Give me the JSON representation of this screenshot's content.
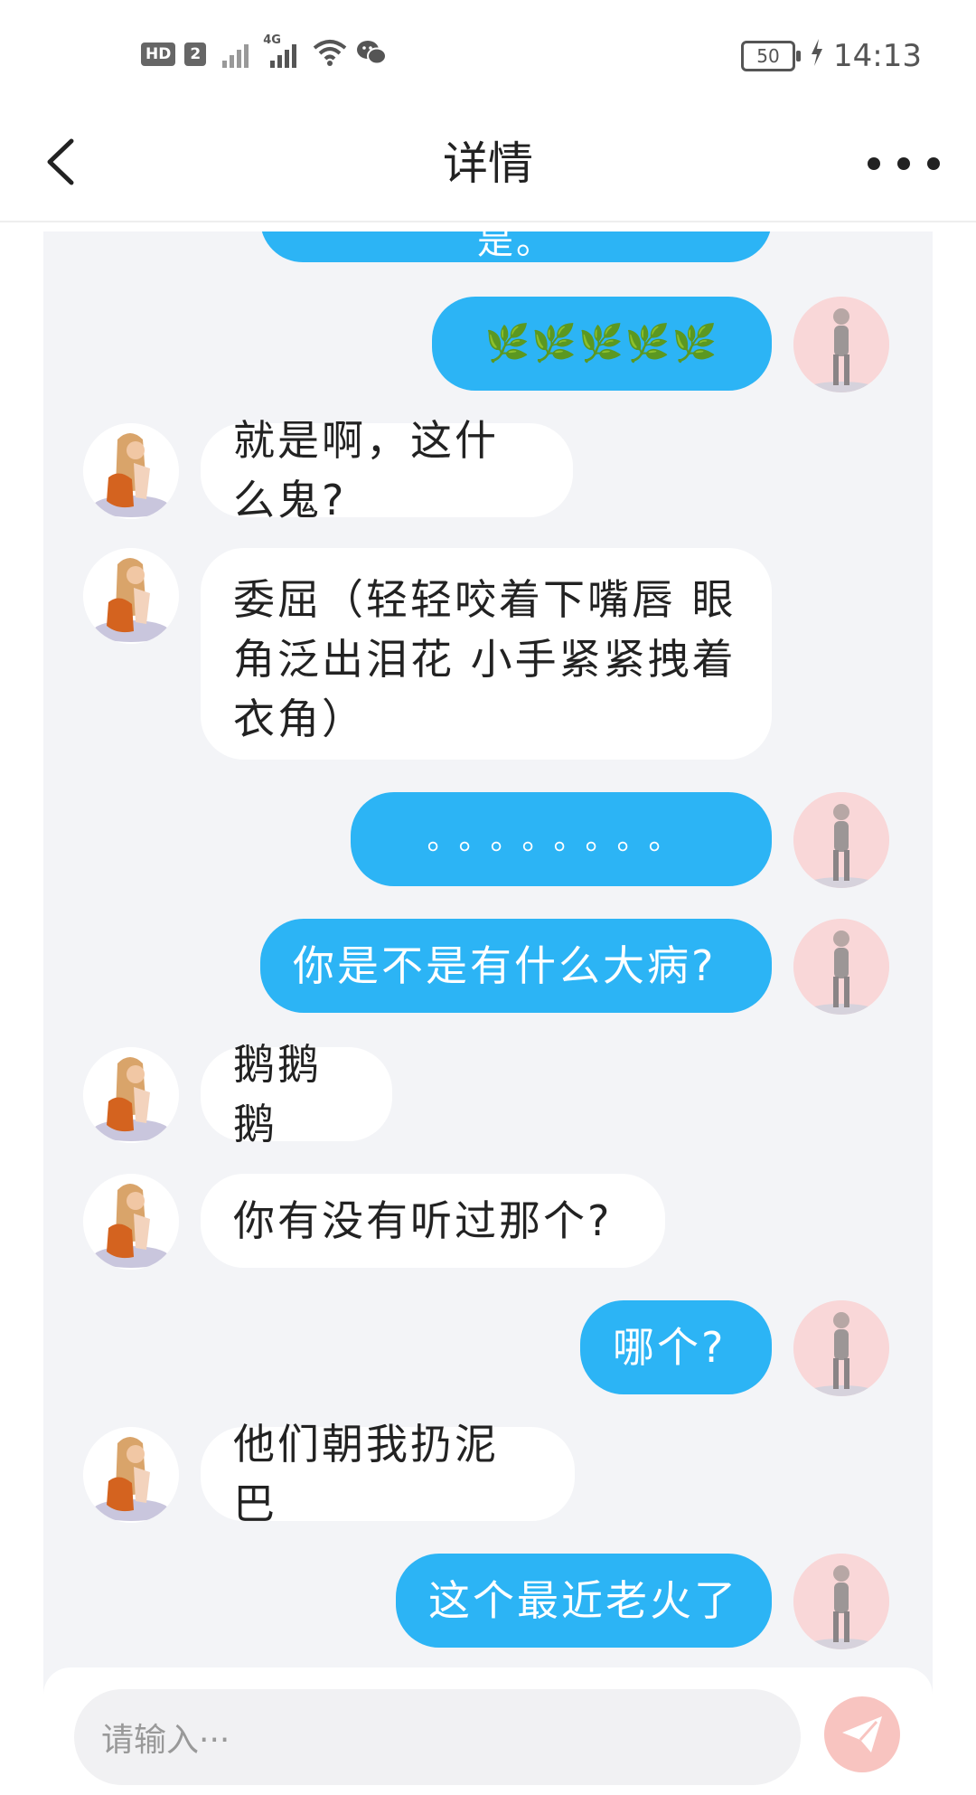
{
  "status_bar": {
    "hd_label": "HD",
    "sim_label": "2",
    "network_label": "4G",
    "battery": "50",
    "time": "14:13"
  },
  "header": {
    "title": "详情"
  },
  "messages": [
    {
      "side": "sent",
      "text": "是。"
    },
    {
      "side": "sent",
      "text": "🌿🌿🌿🌿🌿"
    },
    {
      "side": "received",
      "text": "就是啊，这什么鬼?"
    },
    {
      "side": "received",
      "text": "委屈（轻轻咬着下嘴唇 眼角泛出泪花 小手紧紧拽着衣角）"
    },
    {
      "side": "sent",
      "text": "。。。。。。。。"
    },
    {
      "side": "sent",
      "text": "你是不是有什么大病?"
    },
    {
      "side": "received",
      "text": "鹅鹅鹅"
    },
    {
      "side": "received",
      "text": "你有没有听过那个?"
    },
    {
      "side": "sent",
      "text": "哪个?"
    },
    {
      "side": "received",
      "text": "他们朝我扔泥巴"
    },
    {
      "side": "sent",
      "text": "这个最近老火了"
    }
  ],
  "input": {
    "placeholder": "请输入···"
  },
  "colors": {
    "sent_bubble": "#2cb4f5",
    "received_bubble": "#ffffff",
    "chat_background": "#f3f4f7",
    "send_button": "#f8c4c0"
  }
}
